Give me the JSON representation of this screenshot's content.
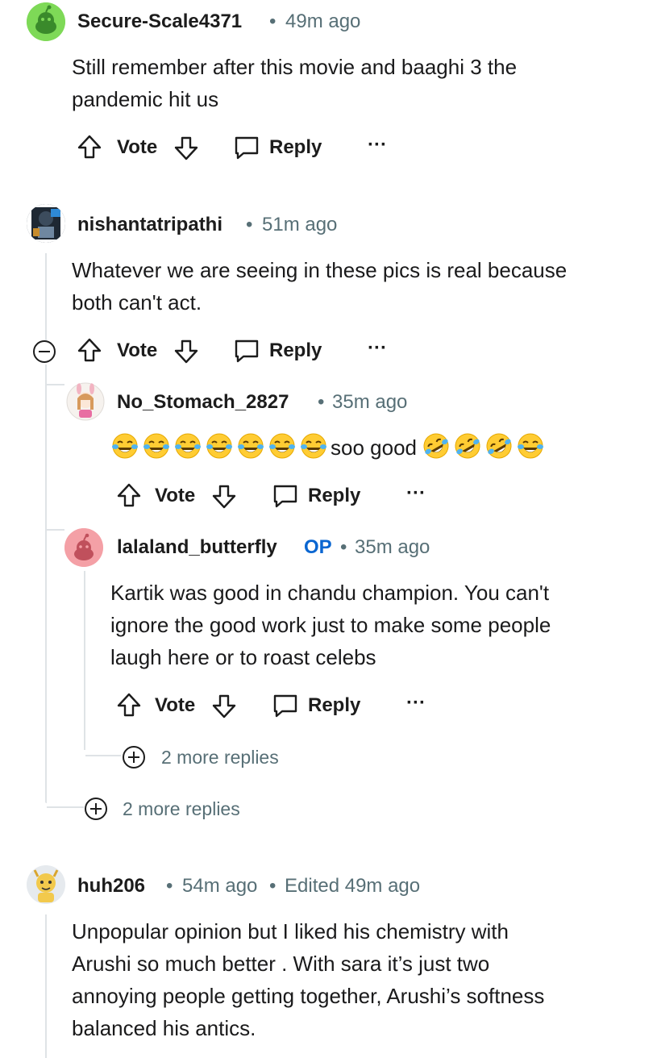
{
  "comments": [
    {
      "username": "Secure-Scale4371",
      "time": "49m ago",
      "body": [
        "Still remember after this movie and baaghi 3 the",
        "pandemic hit us"
      ],
      "vote_label": "Vote",
      "reply_label": "Reply",
      "more_label": "···"
    },
    {
      "username": "nishantatripathi",
      "time": "51m ago",
      "body": [
        "Whatever we are seeing in these pics is real because",
        "both can't act."
      ],
      "vote_label": "Vote",
      "reply_label": "Reply",
      "more_label": "···"
    },
    {
      "username": "No_Stomach_2827",
      "time": "35m ago",
      "body_text": "soo good",
      "emoji_before": 7,
      "emoji_after": [
        "rofl",
        "rofl",
        "rofl",
        "joy"
      ],
      "vote_label": "Vote",
      "reply_label": "Reply",
      "more_label": "···"
    },
    {
      "username": "lalaland_butterfly",
      "badge": "OP",
      "time": "35m ago",
      "body": [
        "Kartik was good in chandu champion. You can't",
        "ignore the good work just to make some people",
        "laugh here or to roast celebs"
      ],
      "vote_label": "Vote",
      "reply_label": "Reply",
      "more_label": "···"
    },
    {
      "username": "huh206",
      "time": "54m ago",
      "edited": "Edited 49m ago",
      "body": [
        "Unpopular opinion but I liked his chemistry with",
        "Arushi so much better . With sara it’s just two",
        "annoying people getting together, Arushi’s softness",
        "balanced his antics."
      ]
    }
  ],
  "more_replies_nested": "2 more replies",
  "more_replies_thread": "2 more replies",
  "separator": "•",
  "colors": {
    "accent_op": "#0a66d1",
    "meta": "#576f76",
    "thread_line": "#dfe3e6"
  }
}
